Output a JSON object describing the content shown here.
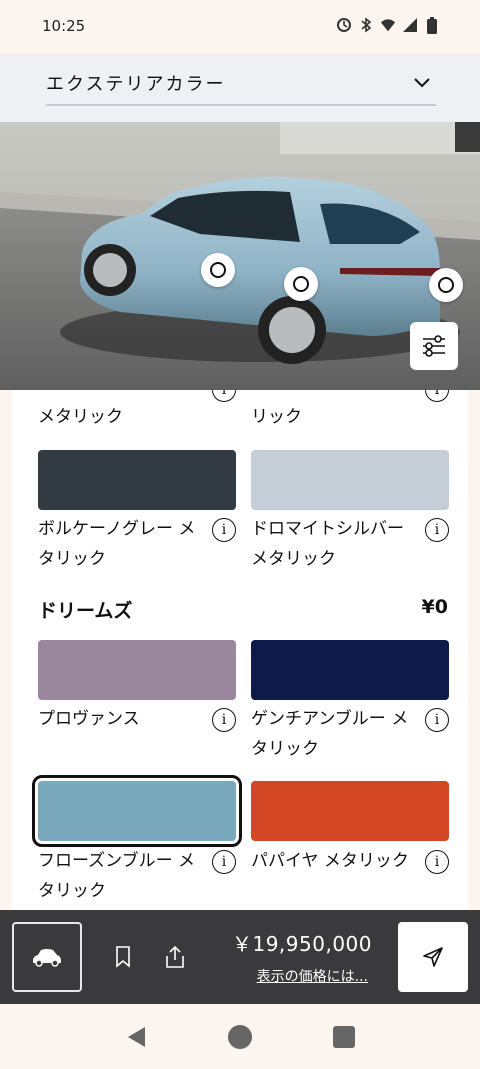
{
  "status_bar": {
    "time": "10:25",
    "icons": [
      "sync-icon",
      "bluetooth-icon",
      "wifi-icon",
      "signal-icon",
      "battery-icon"
    ]
  },
  "header": {
    "dropdown_label": "エクステリアカラー"
  },
  "previous_row": {
    "left_name_tail": "メタリック",
    "right_name_tail": "リック"
  },
  "colors": [
    {
      "name": "ボルケーノグレー メタリック",
      "hex": "#323a42"
    },
    {
      "name": "ドロマイトシルバー メタリック",
      "hex": "#c5ced6"
    }
  ],
  "section": {
    "title": "ドリームズ",
    "price": "¥0"
  },
  "dreams_colors": [
    {
      "name": "プロヴァンス",
      "hex": "#9a879e"
    },
    {
      "name": "ゲンチアンブルー メタリック",
      "hex": "#0d1a4a"
    },
    {
      "name": "フローズンブルー メタリック",
      "hex": "#7aa8bc",
      "selected": true
    },
    {
      "name": "パパイヤ メタリック",
      "hex": "#d44724"
    }
  ],
  "action_bar": {
    "price": "￥19,950,000",
    "price_note": "表示の価格には..."
  },
  "theme": {
    "car_color": "#8fb3c6",
    "bar_color": "#3a3a3c"
  }
}
